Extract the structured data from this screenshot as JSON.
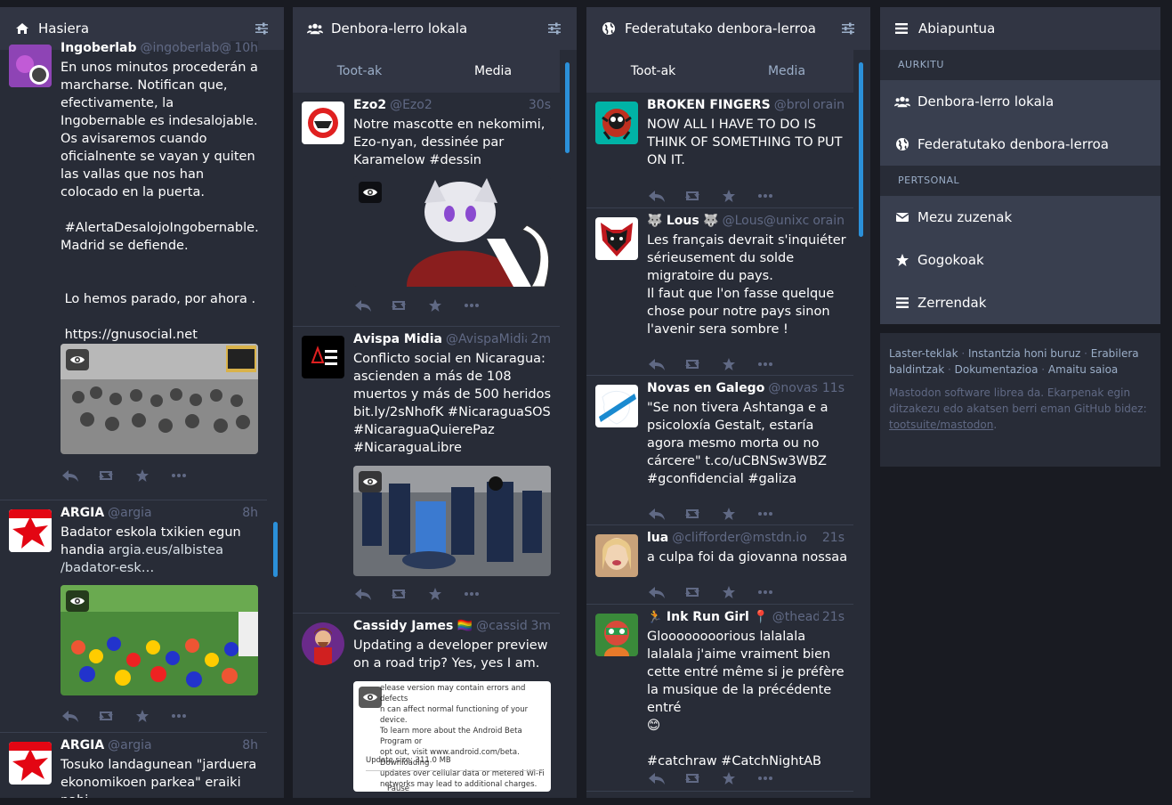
{
  "columns": {
    "home": {
      "title": "Hasiera"
    },
    "local": {
      "title": "Denbora-lerro lokala",
      "tabs": [
        "Toot-ak",
        "Media"
      ],
      "active_tab": 1
    },
    "federated": {
      "title": "Federatutako denbora-lerroa",
      "tabs": [
        "Toot-ak",
        "Media"
      ],
      "active_tab": 0
    }
  },
  "home_statuses": [
    {
      "name": "Ingoberlab",
      "acct": "@ingoberlab@gn…",
      "time": "10h",
      "text": "En unos minutos procederán a marcharse. Notifican que, efectivamente, la Ingobernable es indesalojable. Os avisaremos cuando oficialnente se vayan y quiten las vallas que nos han colocado en la puerta.\n\n #AlertaDesalojoIngobernable.\nMadrid se defiende.\n\n\n Lo hemos parado, por ahora .\n\n https://gnusocial.net\n/attachment/1096462"
    },
    {
      "name": "ARGIA",
      "acct": "@argia",
      "time": "8h",
      "text": "Badator eskola txikien egun handia ",
      "link": "argia.eus/albistea\n/badator-esk…"
    },
    {
      "name": "ARGIA",
      "acct": "@argia",
      "time": "8h",
      "text": "Tosuko landagunean \"jarduera ekonomikoen parkea\" eraiki nahi"
    }
  ],
  "local_statuses": [
    {
      "name": "Ezo2",
      "acct": "@Ezo2",
      "time": "30s",
      "text": "Notre mascotte en nekomimi, Ezo-nyan, dessinée par Karamelow #dessin"
    },
    {
      "name": "Avispa Midia",
      "acct": "@AvispaMidia",
      "time": "2m",
      "text": "Conflicto social en Nicaragua: ascienden a más de 108 muertos y más de 500 heridos bit.ly/2sNhofK #NicaraguaSOS #NicaraguaQuierePaz #NicaraguaLibre"
    },
    {
      "name": "Cassidy James",
      "flag": "🏳️‍🌈",
      "acct": "@cassid…",
      "time": "3m",
      "text": "Updating a developer preview on a road trip? Yes, yes I am."
    }
  ],
  "preview_screenshot": {
    "text": "elease version may contain errors and defects\nn can affect normal functioning of your device.\nTo learn more about the Android Beta Program or\nopt out, visit www.android.com/beta. Downloading\nupdates over cellular data or metered Wi-Fi\nnetworks may lead to additional charges.",
    "size": "Update size: 311.0 MB",
    "pause": "Pause"
  },
  "fed_statuses": [
    {
      "name": "BROKEN FINGERS",
      "acct": "@broken…",
      "time": "orain",
      "text": "NOW ALL I HAVE TO DO IS THINK OF SOMETHING TO PUT ON IT."
    },
    {
      "name": "Lous",
      "prefix": "🐺",
      "suffix": "🐺",
      "acct": "@Lous@unixc…",
      "time": "orain",
      "text": "Les français devrait s'inquiéter sérieusement du solde migratoire du pays.\nIl faut que l'on fasse quelque chose pour notre pays sinon l'avenir sera sombre !"
    },
    {
      "name": "Novas en Galego",
      "acct": "@novas@…",
      "time": "11s",
      "text": "\"Se non tivera Ashtanga e a psicoloxía Gestalt, estaría agora mesmo morta ou no cárcere\" t.co/uCBNSw3WBZ #gconfidencial #galiza"
    },
    {
      "name": "lua",
      "acct": "@clifforder@mstdn.io",
      "time": "21s",
      "text": "a culpa foi da giovanna nossaa"
    },
    {
      "name": "Ink Run Girl",
      "prefix": "🏃",
      "suffix": "📍",
      "acct": "@theadv…",
      "time": "21s",
      "text": "Gloooooooorious lalalala lalalala j'aime vraiment bien cette entré même si je préfère la musique de la précédente entré\n😊\n\n#catchraw #CatchNightAB"
    }
  ],
  "nav": {
    "title": "Abiapuntua",
    "discover_label": "AURKITU",
    "local_label": "Denbora-lerro lokala",
    "federated_label": "Federatutako denbora-lerroa",
    "personal_label": "PERTSONAL",
    "dm_label": "Mezu zuzenak",
    "favourites_label": "Gogokoak",
    "lists_label": "Zerrendak"
  },
  "footer": {
    "links": [
      "Laster-teklak",
      "Instantzia honi buruz",
      "Erabilera baldintzak",
      "Dokumentazioa",
      "Amaitu saioa"
    ],
    "note": "Mastodon software librea da. Ekarpenak egin ditzakezu edo akatsen berri eman GitHub bidez: ",
    "repo": "tootsuite/mastodon"
  },
  "colors": {
    "background": "#191b22",
    "column": "#282c37",
    "header": "#313543",
    "accent": "#2b90d9",
    "muted": "#606984",
    "light_muted": "#9baec8"
  }
}
